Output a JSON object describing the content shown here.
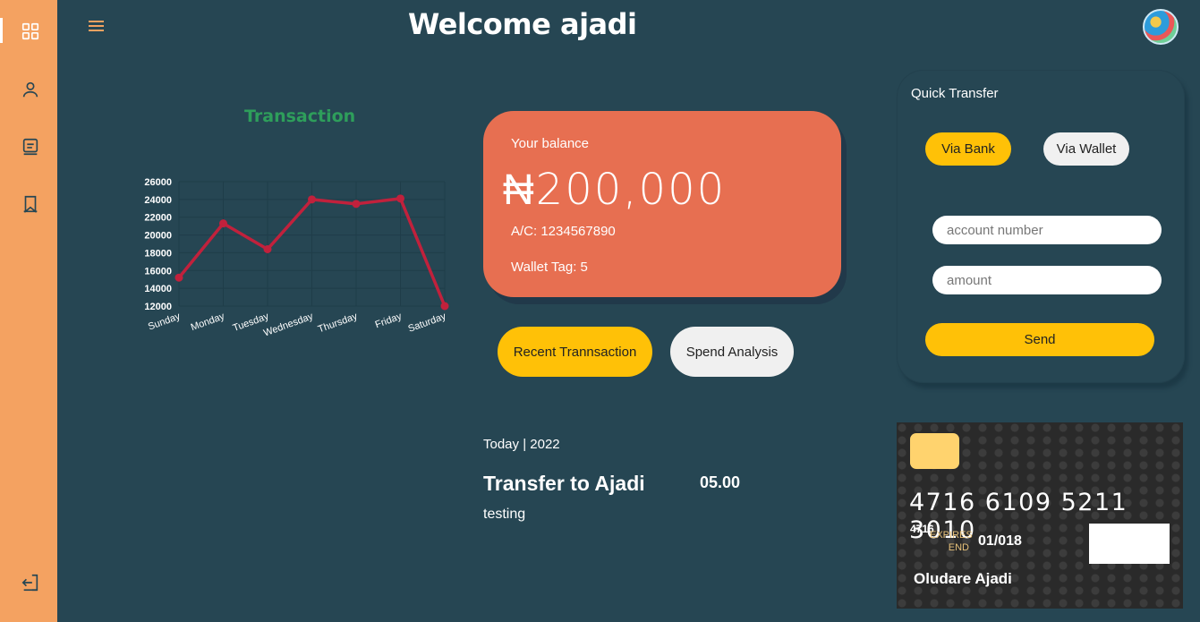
{
  "header": {
    "title": "Welcome ajadi"
  },
  "sidebar": {
    "items": [
      {
        "icon": "grid-icon",
        "active": true
      },
      {
        "icon": "user-icon",
        "active": false
      },
      {
        "icon": "document-icon",
        "active": false
      },
      {
        "icon": "bookmark-icon",
        "active": false
      }
    ],
    "logout_icon": "logout-icon"
  },
  "chart_data": {
    "type": "line",
    "title": "Transaction",
    "categories": [
      "Sunday",
      "Monday",
      "Tuesday",
      "Wednesday",
      "Thursday",
      "Friday",
      "Saturday"
    ],
    "values": [
      15200,
      21300,
      18400,
      24000,
      23500,
      24100,
      12000
    ],
    "ylim": [
      12000,
      26000
    ],
    "yticks": [
      12000,
      14000,
      16000,
      18000,
      20000,
      22000,
      24000,
      26000
    ],
    "line_color": "#c1213c",
    "grid": true
  },
  "balance": {
    "label": "Your balance",
    "amount": "₦200,000",
    "account": "A/C: 1234567890",
    "wallet_tag": "Wallet Tag: 5"
  },
  "actions": {
    "recent": "Recent Trannsaction",
    "spend": "Spend Analysis"
  },
  "transactions": {
    "date_header": "Today | 2022",
    "items": [
      {
        "title": "Transfer to Ajadi",
        "amount": "05.00",
        "description": "testing"
      }
    ]
  },
  "quick_transfer": {
    "title": "Quick Transfer",
    "via_bank": "Via Bank",
    "via_wallet": "Via Wallet",
    "account_placeholder": "account number",
    "amount_placeholder": "amount",
    "send": "Send"
  },
  "card": {
    "number": "4716 6109 5211 3010",
    "small_number": "4716",
    "expires_label": "EXPIRES END",
    "expiry": "01/018",
    "holder": "Oludare Ajadi"
  },
  "colors": {
    "sidebar": "#f4a261",
    "background": "#264653",
    "balance_card": "#e76f51",
    "accent": "#ffc107"
  }
}
